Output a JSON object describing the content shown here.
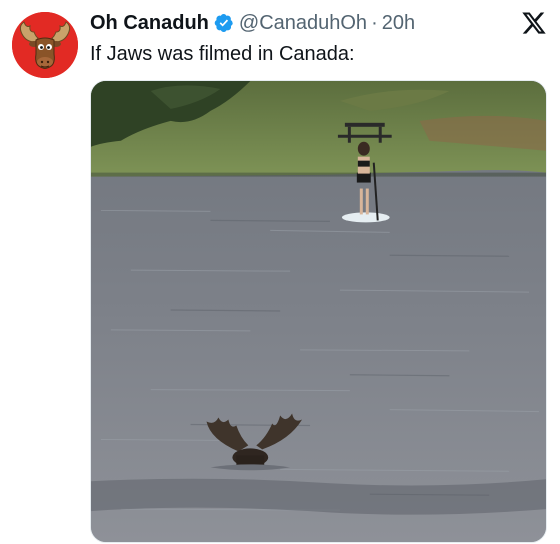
{
  "tweet": {
    "display_name": "Oh Canaduh",
    "handle": "@CanaduhOh",
    "separator": "·",
    "time": "20h",
    "text": "If Jaws was filmed in Canada:"
  },
  "avatar": {
    "icon": "moose-cartoon-avatar",
    "background": "#e22a24"
  },
  "icons": {
    "verified": "verified-badge-icon",
    "platform": "x-logo-icon"
  },
  "colors": {
    "verified_blue": "#1d9bf0",
    "muted_text": "#536471",
    "primary_text": "#0f1419"
  },
  "media": {
    "type": "video-still",
    "subject": "moose-in-lake-with-paddleboarder"
  }
}
